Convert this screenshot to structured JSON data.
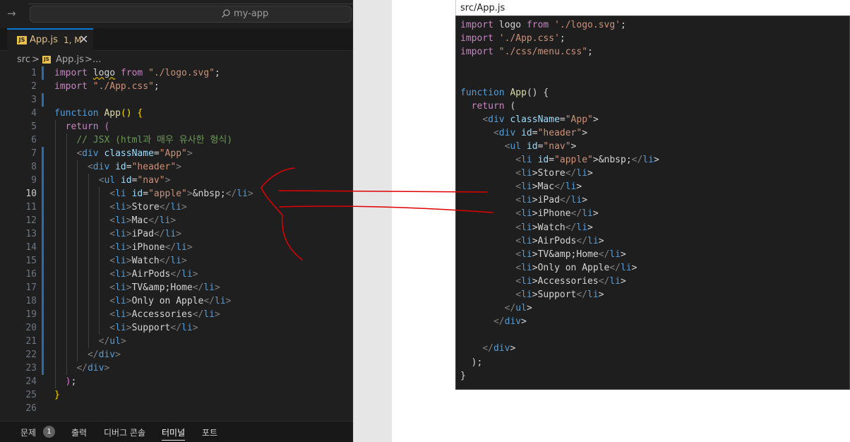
{
  "window": {
    "search_text": "my-app",
    "nav_arrow": "→"
  },
  "tab": {
    "badge": "JS",
    "name": "App.js",
    "status": "1, M",
    "close": "✕"
  },
  "breadcrumb": {
    "folder": "src",
    "separator": ">",
    "badge": "JS",
    "file": "App.js",
    "separator2": ">",
    "rest": "..."
  },
  "editor_lines": [
    {
      "n": "1",
      "indent": 0,
      "t": [
        [
          "kp",
          "import "
        ],
        [
          "tx squig",
          "logo"
        ],
        [
          "kp",
          " from "
        ],
        [
          "str",
          "\"./logo.svg\""
        ],
        [
          "tx",
          ";"
        ]
      ]
    },
    {
      "n": "2",
      "indent": 0,
      "t": [
        [
          "kp",
          "import "
        ],
        [
          "str",
          "\"./App.css\""
        ],
        [
          "tx",
          ";"
        ]
      ]
    },
    {
      "n": "3",
      "indent": 0,
      "t": []
    },
    {
      "n": "4",
      "indent": 0,
      "t": [
        [
          "kw",
          "function "
        ],
        [
          "fn",
          "App"
        ],
        [
          "pn1",
          "() {"
        ]
      ]
    },
    {
      "n": "5",
      "indent": 1,
      "t": [
        [
          "kp",
          "return "
        ],
        [
          "pn2",
          "("
        ]
      ]
    },
    {
      "n": "6",
      "indent": 2,
      "t": [
        [
          "cm",
          "// JSX (html과 매우 유사한 형식)"
        ]
      ]
    },
    {
      "n": "7",
      "indent": 2,
      "t": [
        [
          "ph",
          "<"
        ],
        [
          "tag",
          "div "
        ],
        [
          "att",
          "className"
        ],
        [
          "tx",
          "="
        ],
        [
          "str",
          "\"App\""
        ],
        [
          "ph",
          ">"
        ]
      ]
    },
    {
      "n": "8",
      "indent": 3,
      "t": [
        [
          "ph",
          "<"
        ],
        [
          "tag",
          "div "
        ],
        [
          "att",
          "id"
        ],
        [
          "tx",
          "="
        ],
        [
          "str",
          "\"header\""
        ],
        [
          "ph",
          ">"
        ]
      ]
    },
    {
      "n": "9",
      "indent": 4,
      "t": [
        [
          "ph",
          "<"
        ],
        [
          "tag",
          "ul "
        ],
        [
          "att",
          "id"
        ],
        [
          "tx",
          "="
        ],
        [
          "str",
          "\"nav\""
        ],
        [
          "ph",
          ">"
        ]
      ]
    },
    {
      "n": "10",
      "indent": 5,
      "t": [
        [
          "ph",
          "<"
        ],
        [
          "tag",
          "li "
        ],
        [
          "att",
          "id"
        ],
        [
          "tx",
          "="
        ],
        [
          "str",
          "\"apple\""
        ],
        [
          "ph",
          ">"
        ],
        [
          "tx",
          "&nbsp;"
        ],
        [
          "ph",
          "</"
        ],
        [
          "tag",
          "li"
        ],
        [
          "ph",
          ">"
        ]
      ]
    },
    {
      "n": "11",
      "indent": 5,
      "t": [
        [
          "ph",
          "<"
        ],
        [
          "tag",
          "li"
        ],
        [
          "ph",
          ">"
        ],
        [
          "tx",
          "Store"
        ],
        [
          "ph",
          "</"
        ],
        [
          "tag",
          "li"
        ],
        [
          "ph",
          ">"
        ]
      ]
    },
    {
      "n": "12",
      "indent": 5,
      "t": [
        [
          "ph",
          "<"
        ],
        [
          "tag",
          "li"
        ],
        [
          "ph",
          ">"
        ],
        [
          "tx",
          "Mac"
        ],
        [
          "ph",
          "</"
        ],
        [
          "tag",
          "li"
        ],
        [
          "ph",
          ">"
        ]
      ]
    },
    {
      "n": "13",
      "indent": 5,
      "t": [
        [
          "ph",
          "<"
        ],
        [
          "tag",
          "li"
        ],
        [
          "ph",
          ">"
        ],
        [
          "tx",
          "iPad"
        ],
        [
          "ph",
          "</"
        ],
        [
          "tag",
          "li"
        ],
        [
          "ph",
          ">"
        ]
      ]
    },
    {
      "n": "14",
      "indent": 5,
      "t": [
        [
          "ph",
          "<"
        ],
        [
          "tag",
          "li"
        ],
        [
          "ph",
          ">"
        ],
        [
          "tx",
          "iPhone"
        ],
        [
          "ph",
          "</"
        ],
        [
          "tag",
          "li"
        ],
        [
          "ph",
          ">"
        ]
      ]
    },
    {
      "n": "15",
      "indent": 5,
      "t": [
        [
          "ph",
          "<"
        ],
        [
          "tag",
          "li"
        ],
        [
          "ph",
          ">"
        ],
        [
          "tx",
          "Watch"
        ],
        [
          "ph",
          "</"
        ],
        [
          "tag",
          "li"
        ],
        [
          "ph",
          ">"
        ]
      ]
    },
    {
      "n": "16",
      "indent": 5,
      "t": [
        [
          "ph",
          "<"
        ],
        [
          "tag",
          "li"
        ],
        [
          "ph",
          ">"
        ],
        [
          "tx",
          "AirPods"
        ],
        [
          "ph",
          "</"
        ],
        [
          "tag",
          "li"
        ],
        [
          "ph",
          ">"
        ]
      ]
    },
    {
      "n": "17",
      "indent": 5,
      "t": [
        [
          "ph",
          "<"
        ],
        [
          "tag",
          "li"
        ],
        [
          "ph",
          ">"
        ],
        [
          "tx",
          "TV&amp;Home"
        ],
        [
          "ph",
          "</"
        ],
        [
          "tag",
          "li"
        ],
        [
          "ph",
          ">"
        ]
      ]
    },
    {
      "n": "18",
      "indent": 5,
      "t": [
        [
          "ph",
          "<"
        ],
        [
          "tag",
          "li"
        ],
        [
          "ph",
          ">"
        ],
        [
          "tx",
          "Only on Apple"
        ],
        [
          "ph",
          "</"
        ],
        [
          "tag",
          "li"
        ],
        [
          "ph",
          ">"
        ]
      ]
    },
    {
      "n": "19",
      "indent": 5,
      "t": [
        [
          "ph",
          "<"
        ],
        [
          "tag",
          "li"
        ],
        [
          "ph",
          ">"
        ],
        [
          "tx",
          "Accessories"
        ],
        [
          "ph",
          "</"
        ],
        [
          "tag",
          "li"
        ],
        [
          "ph",
          ">"
        ]
      ]
    },
    {
      "n": "20",
      "indent": 5,
      "t": [
        [
          "ph",
          "<"
        ],
        [
          "tag",
          "li"
        ],
        [
          "ph",
          ">"
        ],
        [
          "tx",
          "Support"
        ],
        [
          "ph",
          "</"
        ],
        [
          "tag",
          "li"
        ],
        [
          "ph",
          ">"
        ]
      ]
    },
    {
      "n": "21",
      "indent": 4,
      "t": [
        [
          "ph",
          "</"
        ],
        [
          "tag",
          "ul"
        ],
        [
          "ph",
          ">"
        ]
      ]
    },
    {
      "n": "22",
      "indent": 3,
      "t": [
        [
          "ph",
          "</"
        ],
        [
          "tag",
          "div"
        ],
        [
          "ph",
          ">"
        ]
      ]
    },
    {
      "n": "23",
      "indent": 2,
      "t": [
        [
          "ph",
          "</"
        ],
        [
          "tag",
          "div"
        ],
        [
          "ph",
          ">"
        ]
      ]
    },
    {
      "n": "24",
      "indent": 1,
      "t": [
        [
          "pn2",
          ")"
        ],
        [
          "tx",
          ";"
        ]
      ]
    },
    {
      "n": "25",
      "indent": 0,
      "t": [
        [
          "pn1",
          "}"
        ]
      ]
    },
    {
      "n": "26",
      "indent": 0,
      "t": []
    }
  ],
  "panel_tabs": {
    "problems": "문제",
    "problems_count": "1",
    "output": "출력",
    "debug_console": "디버그 콘솔",
    "terminal": "터미널",
    "ports": "포트"
  },
  "reference": {
    "title": "src/App.js",
    "lines": [
      "import logo from './logo.svg';",
      "import './App.css';",
      "import \"./css/menu.css\";",
      "",
      "",
      "function App() {",
      "  return (",
      "    <div className=\"App\">",
      "      <div id=\"header\">",
      "        <ul id=\"nav\">",
      "          <li id=\"apple\">&nbsp;</li>",
      "          <li>Store</li>",
      "          <li>Mac</li>",
      "          <li>iPad</li>",
      "          <li>iPhone</li>",
      "          <li>Watch</li>",
      "          <li>AirPods</li>",
      "          <li>TV&amp;Home</li>",
      "          <li>Only on Apple</li>",
      "          <li>Accessories</li>",
      "          <li>Support</li>",
      "        </ul>",
      "      </div>",
      "",
      "    </div>",
      "  );",
      "}"
    ]
  },
  "colors": {
    "annotation": "#e00000",
    "modified_bar": "#2f6ca5",
    "keyword": "#569cd6",
    "string": "#ce9178"
  }
}
